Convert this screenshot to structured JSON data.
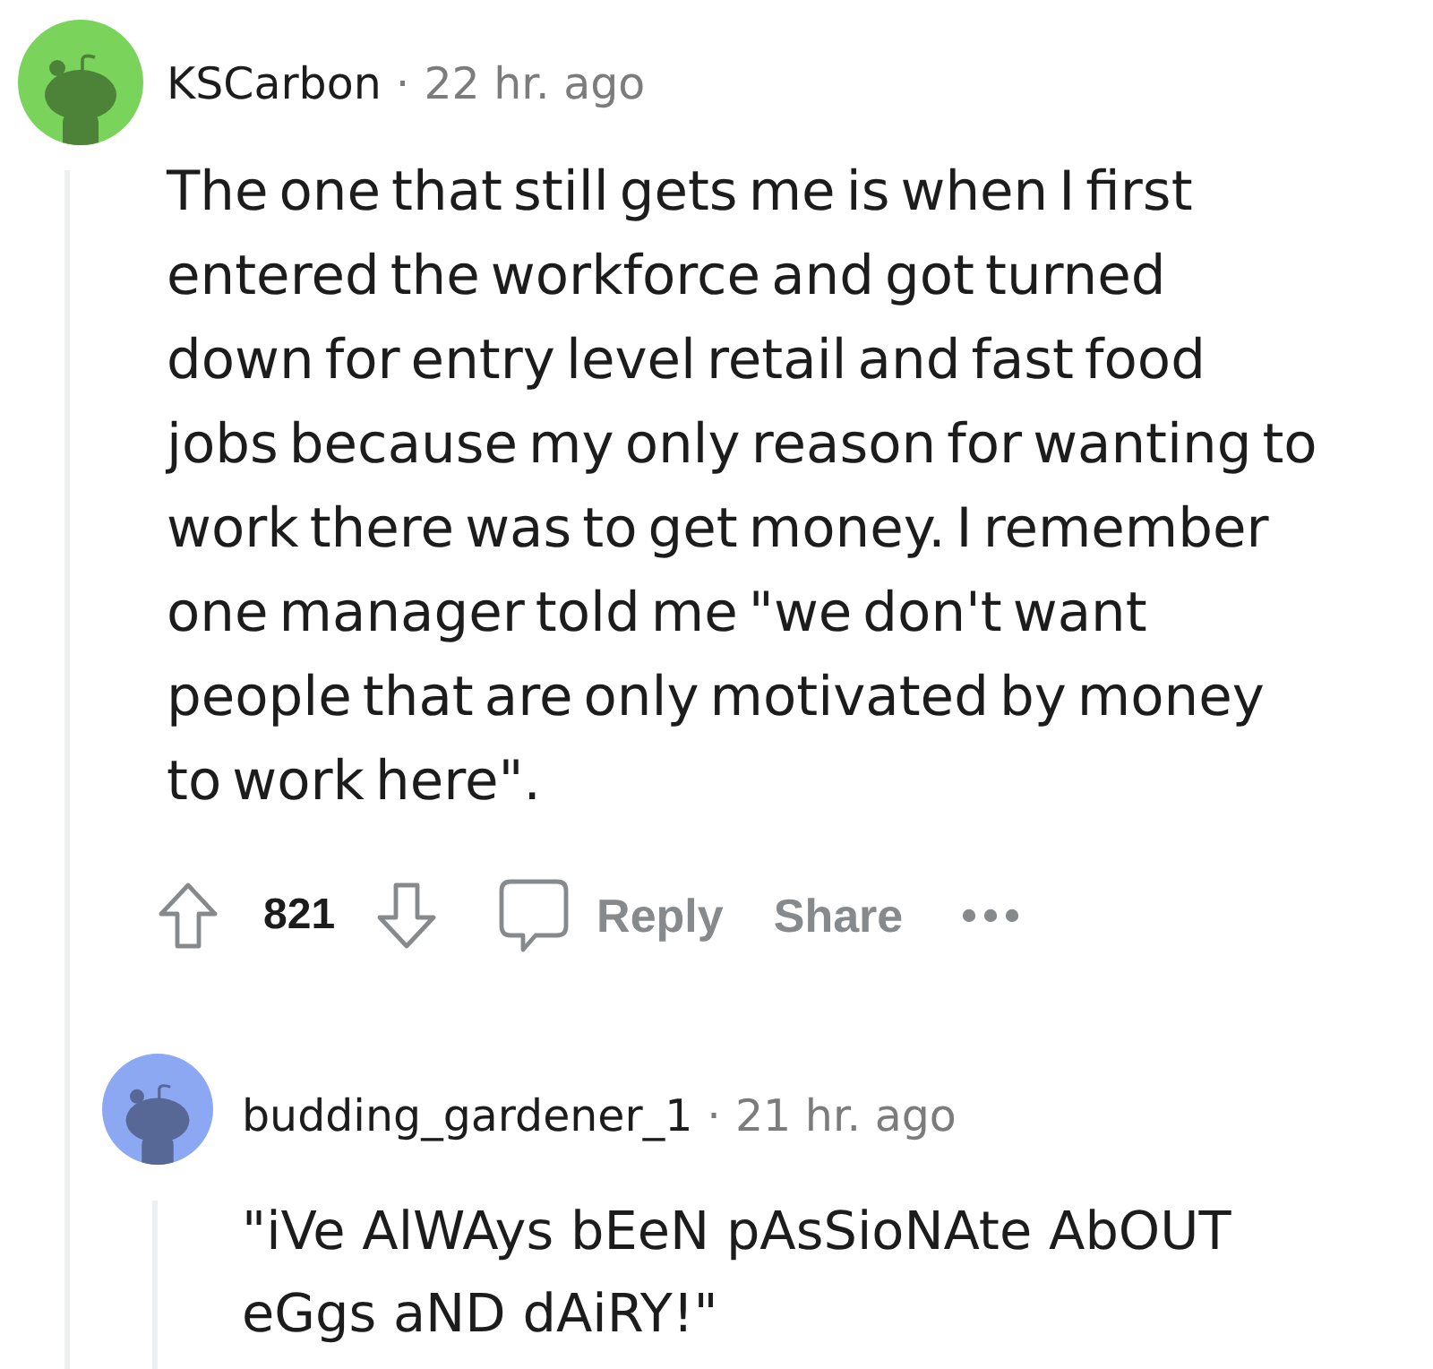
{
  "comments": [
    {
      "author": "KSCarbon",
      "separator": "·",
      "time": "22 hr. ago",
      "color": "#7ad35a",
      "body": "The one that still gets me is when I first entered the workforce and got turned down for entry level retail and fast food jobs because my only reason for wanting to work there was to get money. I remember one manager told me \"we don't want people that are only motivated by money to work here\".",
      "votes": "821",
      "actions": [
        {
          "kind": "reply",
          "label": "Reply"
        },
        {
          "kind": "share",
          "label": "Share"
        }
      ],
      "replies": [
        {
          "author": "budding_gardener_1",
          "separator": "·",
          "time": "21 hr. ago",
          "color": "#8ca8f2",
          "body": "\"iVe AlWAys bEeN pAsSioNAte AbOUT eGgs aND dAiRY!\""
        }
      ]
    }
  ]
}
